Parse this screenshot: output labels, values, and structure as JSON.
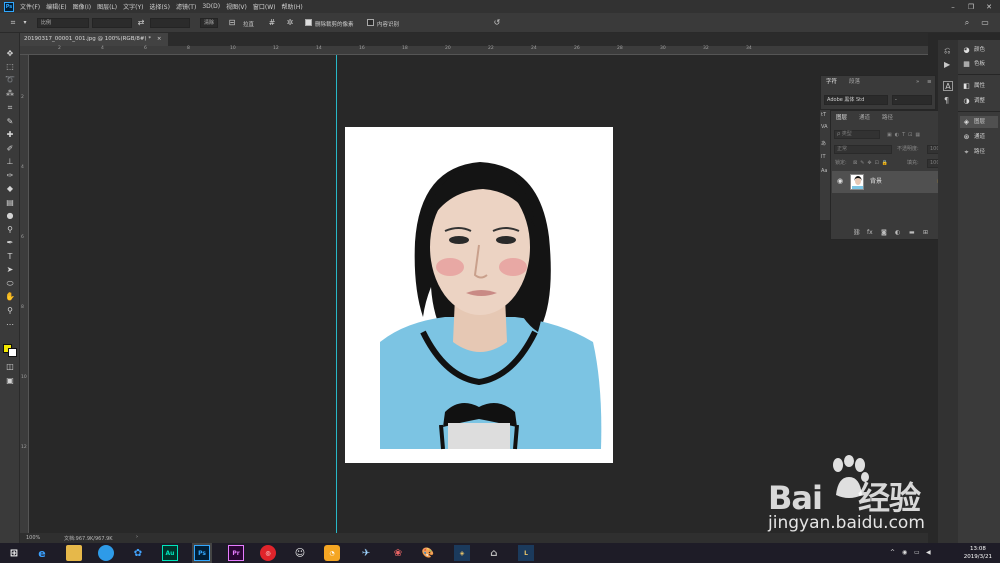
{
  "app": {
    "logo": "Ps",
    "menu": [
      "文件(F)",
      "编辑(E)",
      "图像(I)",
      "图层(L)",
      "文字(Y)",
      "选择(S)",
      "滤镜(T)",
      "3D(D)",
      "视图(V)",
      "窗口(W)",
      "帮助(H)"
    ]
  },
  "options": {
    "ratio_value": "比例",
    "clear_label": "清除",
    "straighten_label": "拉直",
    "delete_cropped_label": "删除裁剪的像素",
    "content_aware_label": "内容识别",
    "delete_cropped_checked": true,
    "content_aware_checked": false
  },
  "document": {
    "tab_title": "20190317_00001_001.jpg @ 100%(RGB/8#) *",
    "tab_close": "×",
    "zoom": "100%",
    "doc_size": "文档:967.9K/967.9K"
  },
  "rulers": {
    "top": [
      "2",
      "4",
      "6",
      "8",
      "10",
      "12",
      "14",
      "16",
      "18",
      "20",
      "22",
      "24",
      "26",
      "28",
      "30",
      "32",
      "34"
    ],
    "left": [
      "2",
      "4",
      "6",
      "8",
      "10",
      "12"
    ]
  },
  "dock": {
    "group1": [
      "颜色",
      "色板"
    ],
    "group2": [
      "属性",
      "调整"
    ],
    "group3": [
      "图层",
      "通道",
      "路径"
    ]
  },
  "character_panel": {
    "tabs": [
      "字符",
      "段落"
    ],
    "font": "Adobe 黑体 Std",
    "style": "-"
  },
  "layers_panel": {
    "tabs": [
      "图层",
      "通道",
      "路径"
    ],
    "kind_placeholder": "ρ 类型",
    "blend_mode": "正常",
    "opacity_label": "不透明度:",
    "opacity_value": "100%",
    "lock_label": "锁定:",
    "fill_label": "填充:",
    "fill_value": "100%",
    "layer_name": "背景"
  },
  "watermark": {
    "brand": "Bai",
    "brand_suffix": "经验",
    "url": "jingyan.baidu.com"
  },
  "taskbar": {
    "time": "13:08",
    "date": "2019/3/21",
    "apps": [
      "Au",
      "Ps",
      "Pr"
    ]
  },
  "colors": {
    "foreground": "#f2e600",
    "background": "#ffffff",
    "guide": "#28b8c8"
  }
}
